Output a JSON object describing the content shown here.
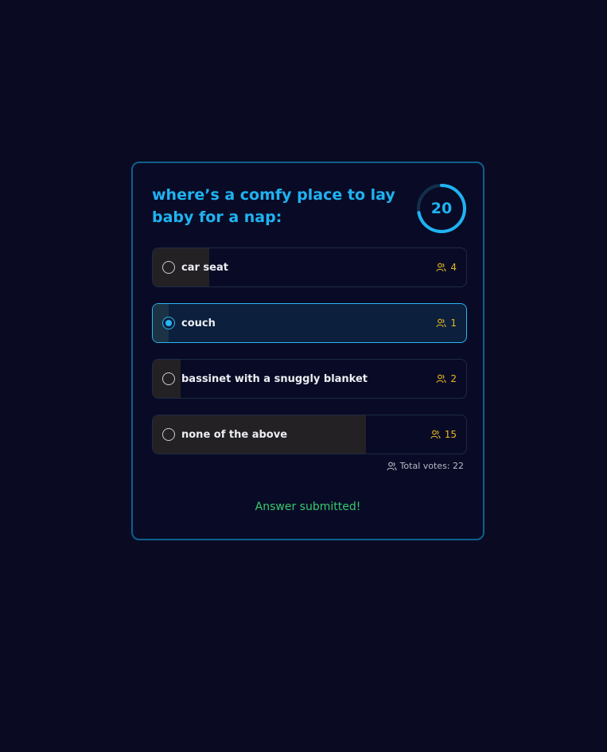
{
  "poll": {
    "question": "where’s a comfy place to lay baby for a nap:",
    "timer": {
      "value": "20",
      "fraction_remaining": 0.72
    },
    "options": [
      {
        "label": "car seat",
        "votes": "4",
        "share": 0.18,
        "selected": false
      },
      {
        "label": "couch",
        "votes": "1",
        "share": 0.05,
        "selected": true
      },
      {
        "label": "bassinet with a snuggly blanket",
        "votes": "2",
        "share": 0.09,
        "selected": false
      },
      {
        "label": "none of the above",
        "votes": "15",
        "share": 0.68,
        "selected": false
      }
    ],
    "total_votes": "Total votes: 22",
    "status": "Answer submitted!"
  },
  "colors": {
    "background": "#0a0b23",
    "accent": "#1fb3f2",
    "votes": "#e8b820",
    "success": "#35c96d"
  },
  "icons": {
    "vote_count": "users-icon",
    "total_votes": "users-icon"
  }
}
